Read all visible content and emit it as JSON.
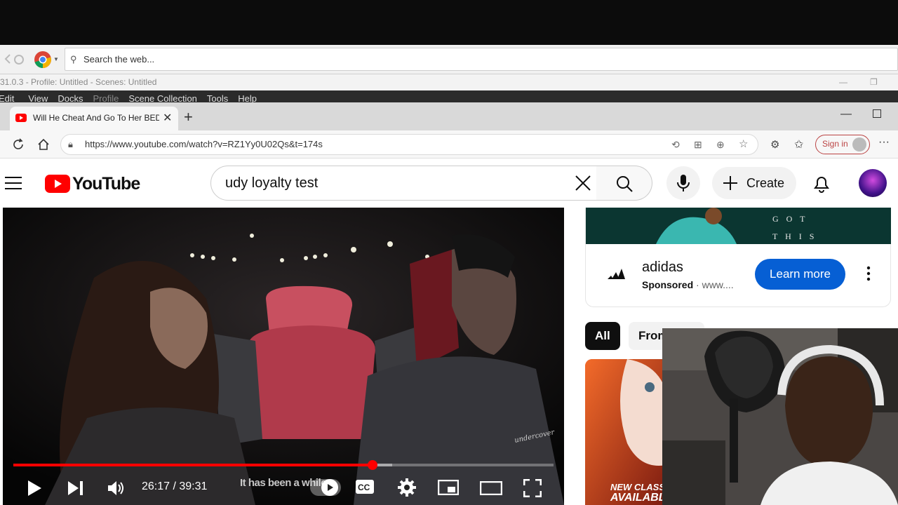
{
  "obs": {
    "search_placeholder": "Search the web...",
    "title": "31.0.3 - Profile: Untitled - Scenes: Untitled",
    "menu": [
      "Edit",
      "View",
      "Docks",
      "Profile",
      "Scene Collection",
      "Tools",
      "Help"
    ]
  },
  "browser": {
    "tab_title": "Will He Cheat And Go To Her BED",
    "url": "https://www.youtube.com/watch?v=RZ1Yy0U02Qs&t=174s",
    "sign_in": "Sign in"
  },
  "youtube": {
    "logo": "YouTube",
    "search_value": "udy loyalty test",
    "create_label": "Create",
    "player": {
      "time": "26:17 / 39:31",
      "caption": "It has been a while",
      "progress_fraction": 0.6646
    },
    "ad": {
      "banner_text_1": "G O T",
      "banner_text_2": "T H I S",
      "brand": "adidas",
      "sponsored": "Sponsored",
      "domain": "www....",
      "cta": "Learn more"
    },
    "chips": [
      "All",
      "From"
    ],
    "thumb_text_1": "NEW CLASS",
    "thumb_text_2": "AVAILABL"
  },
  "colors": {
    "yt_red": "#ff0000",
    "progress": "#f00",
    "learn_btn": "#065fd4"
  }
}
